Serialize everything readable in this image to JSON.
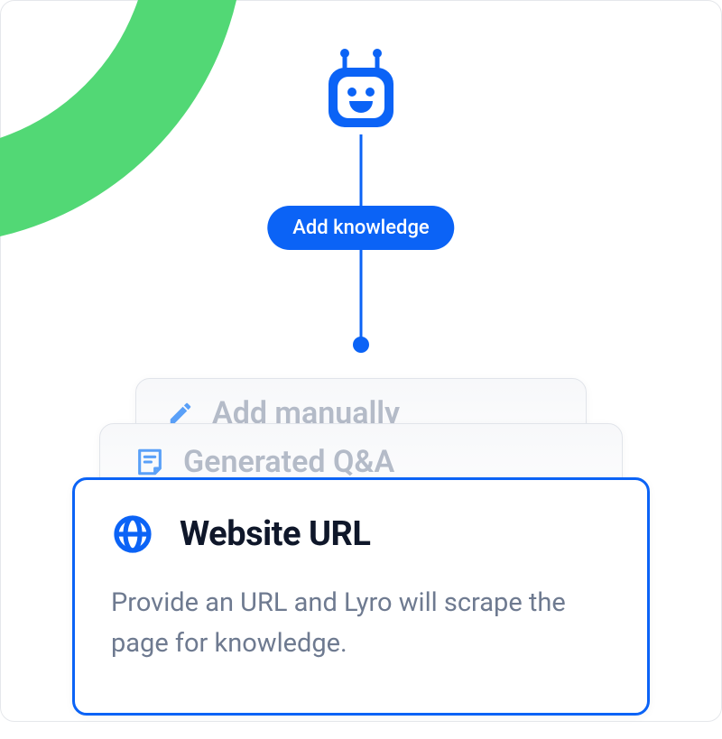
{
  "badge": {
    "label": "Add knowledge"
  },
  "options": [
    {
      "id": "manual",
      "icon": "pencil-icon",
      "title": "Add manually"
    },
    {
      "id": "generated-qa",
      "icon": "note-icon",
      "title": "Generated Q&A"
    },
    {
      "id": "website-url",
      "icon": "globe-icon",
      "title": "Website URL",
      "description": "Provide an URL and Lyro will scrape the page for knowledge."
    }
  ],
  "colors": {
    "primary": "#0b63f6",
    "accent": "#52d875",
    "ghost": "#b4bbc8",
    "text": "#0f172a",
    "muted": "#6e7a90"
  }
}
